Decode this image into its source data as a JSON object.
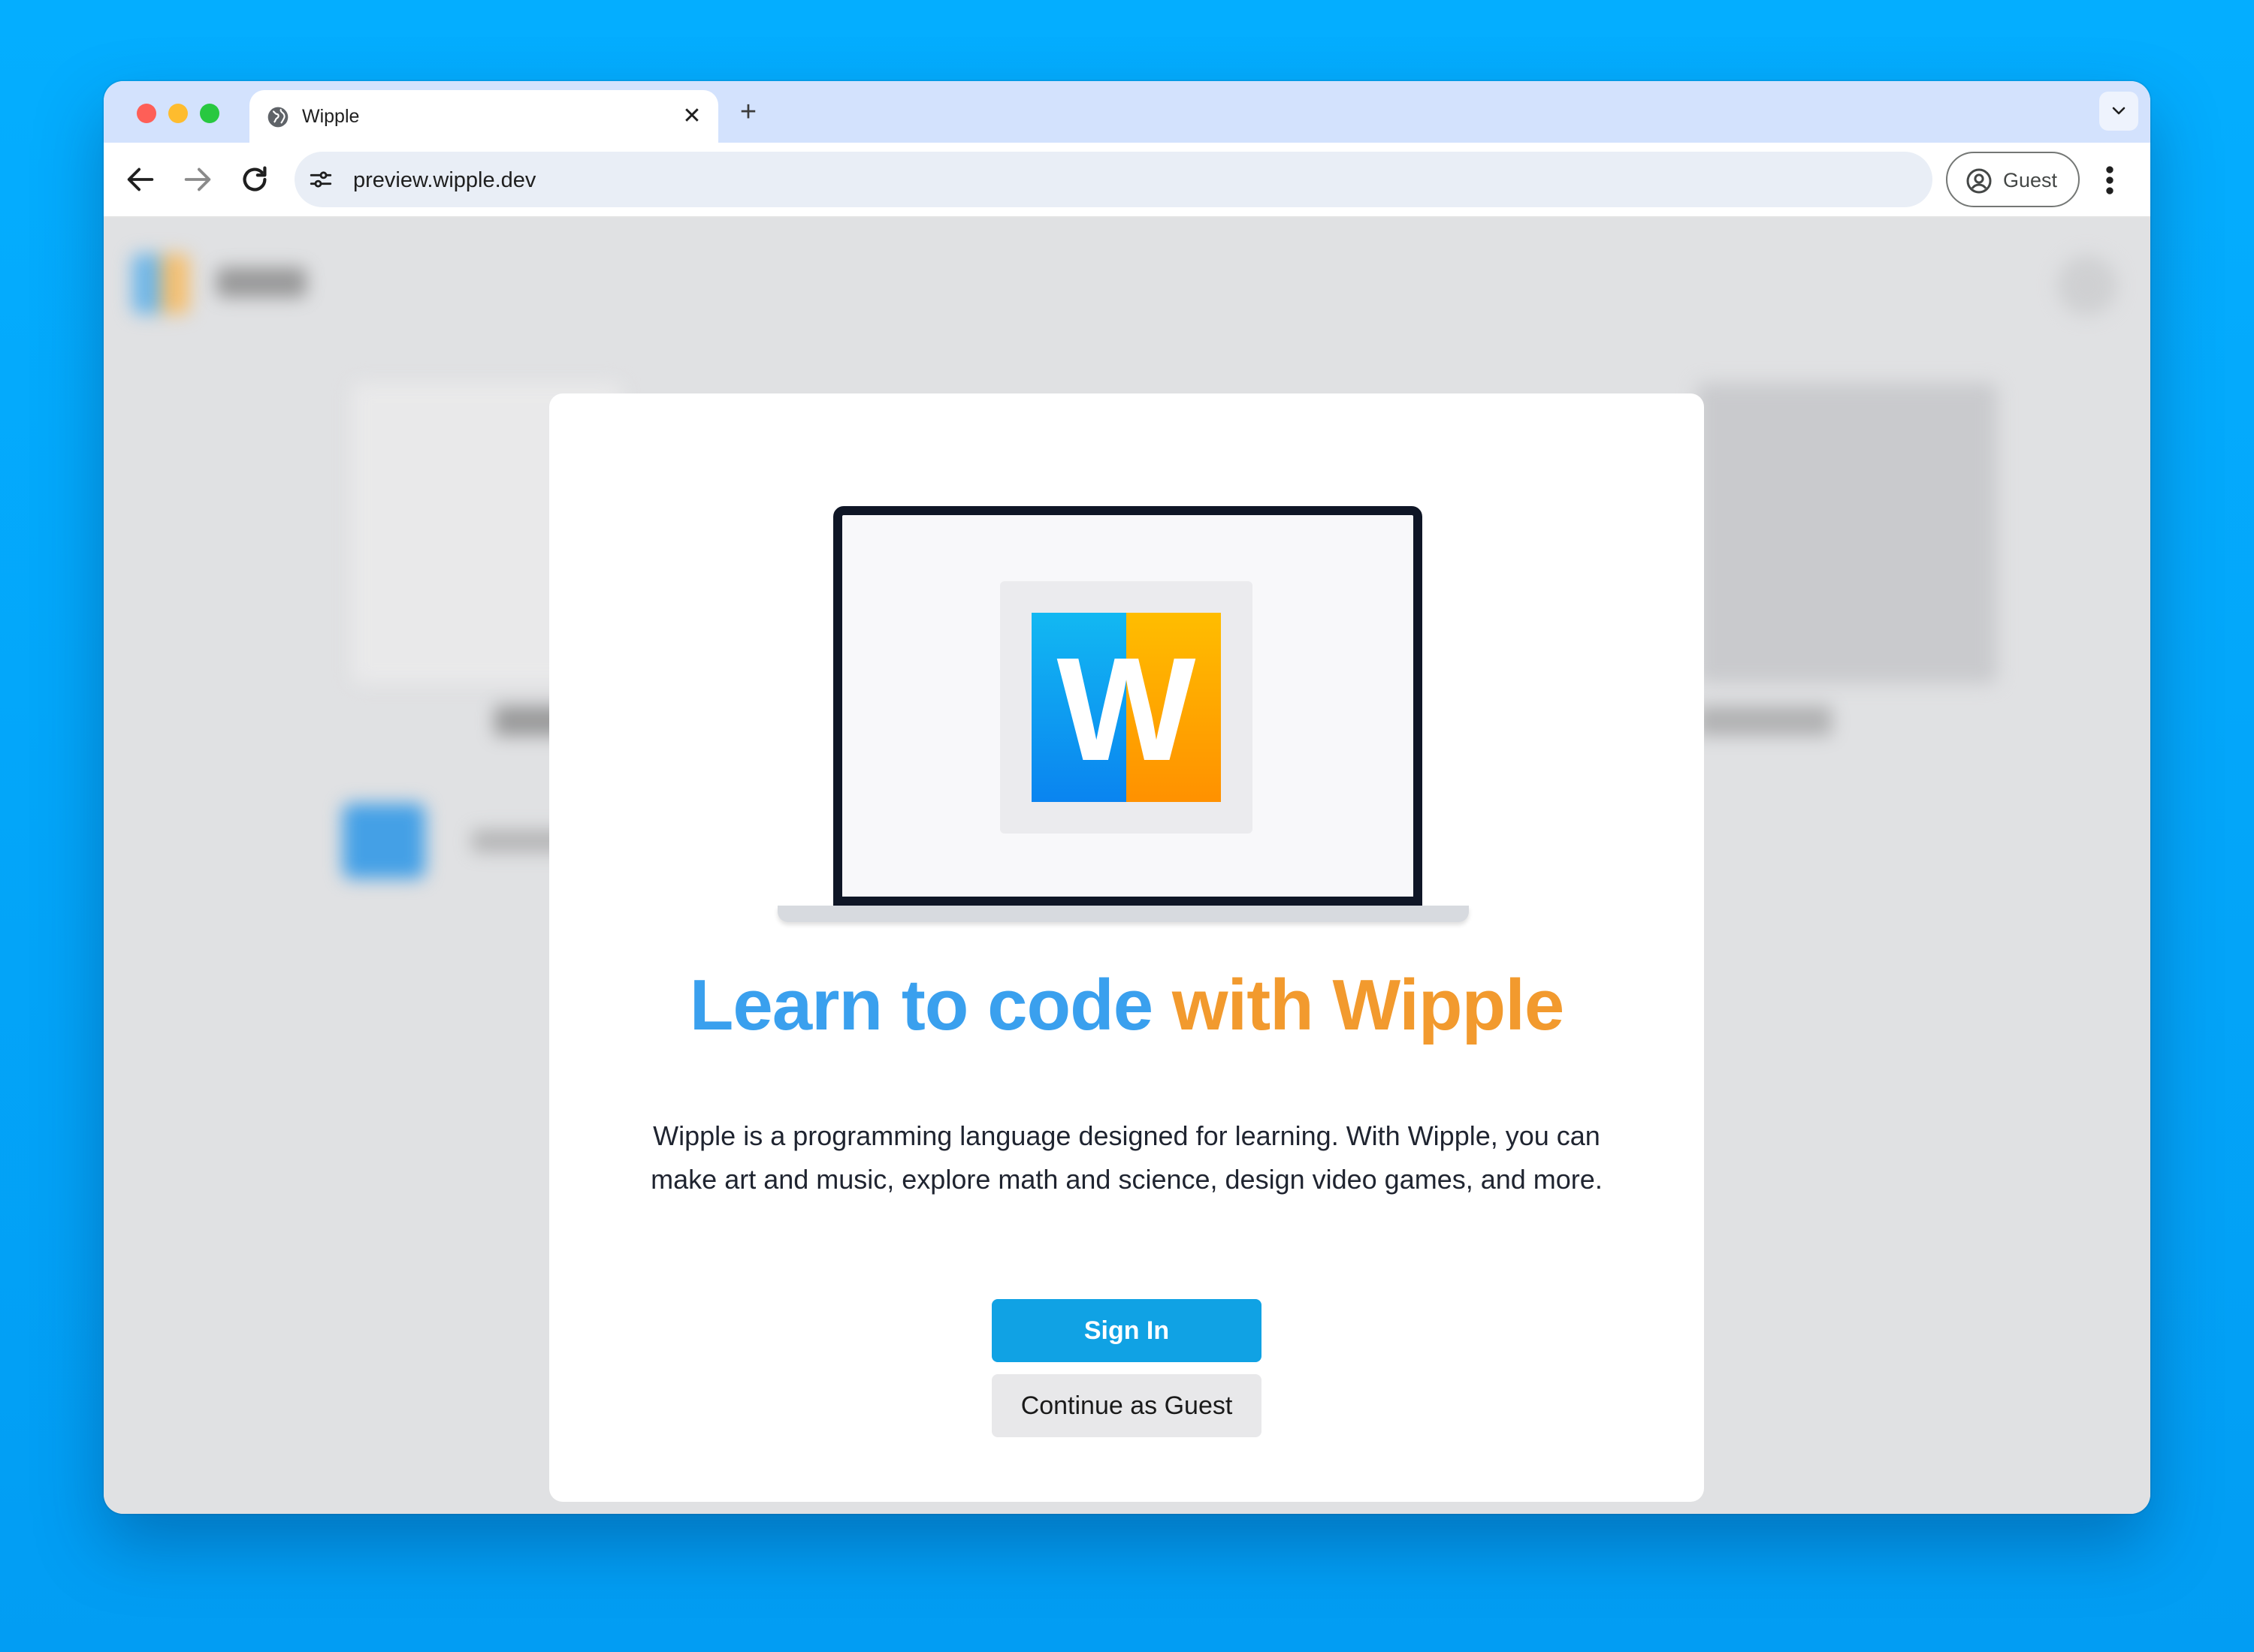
{
  "browser": {
    "tab_title": "Wipple",
    "tab_close": "✕",
    "new_tab": "+",
    "url": "preview.wipple.dev",
    "profile_label": "Guest"
  },
  "modal": {
    "logo_letter": "W",
    "headline_part1": "Learn to code",
    "headline_part2": "with Wipple",
    "description": "Wipple is a programming language designed for learning. With Wipple, you can make art and music, explore math and science, design video games, and more.",
    "signin_label": "Sign In",
    "guest_label": "Continue as Guest"
  },
  "colors": {
    "background": "#04aeff",
    "headline_blue": "#3aa0ee",
    "headline_orange": "#f29a2e",
    "signin_button": "#10a2e4",
    "guest_button": "#e8e8ea"
  },
  "icons": [
    "globe-icon",
    "close-icon",
    "plus-icon",
    "chevron-down-icon",
    "back-arrow-icon",
    "forward-arrow-icon",
    "reload-icon",
    "site-settings-icon",
    "account-icon",
    "more-vert-icon"
  ]
}
